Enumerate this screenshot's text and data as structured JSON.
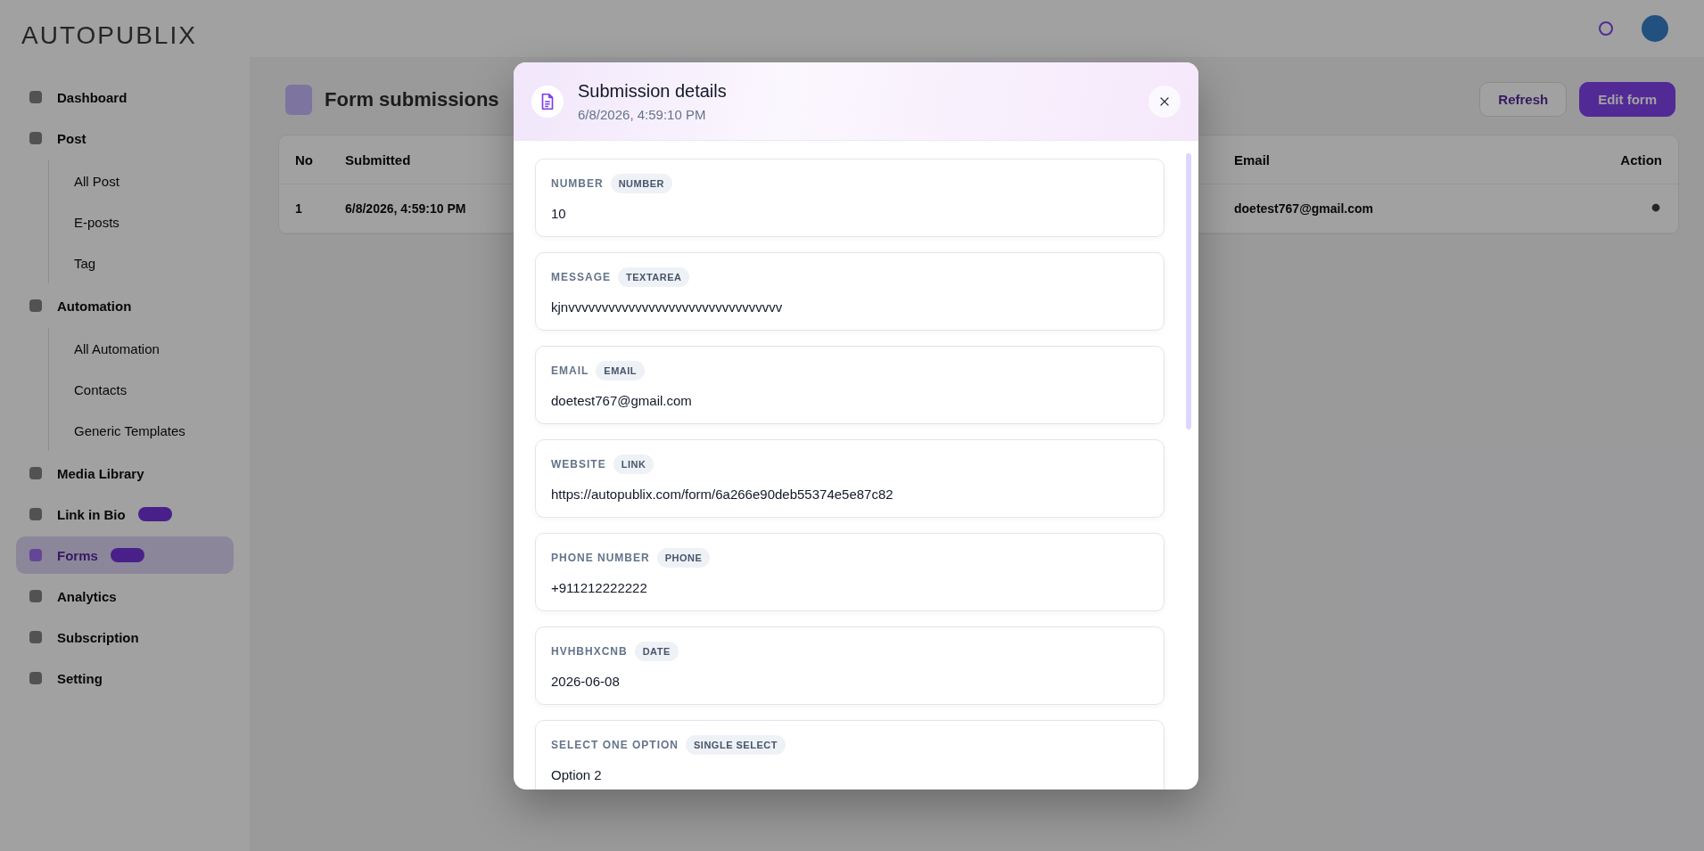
{
  "brand": {
    "logo": "AUTOPUBLIX"
  },
  "sidebar": {
    "items": [
      {
        "label": "Dashboard",
        "selected": false,
        "badge": false
      },
      {
        "label": "Post",
        "selected": false,
        "badge": false,
        "children": [
          {
            "label": "All Post"
          },
          {
            "label": "E-posts"
          },
          {
            "label": "Tag"
          }
        ]
      },
      {
        "label": "Automation",
        "selected": false,
        "badge": false,
        "children": [
          {
            "label": "All Automation"
          },
          {
            "label": "Contacts"
          },
          {
            "label": "Generic Templates"
          }
        ]
      },
      {
        "label": "Media Library",
        "selected": false,
        "badge": false
      },
      {
        "label": "Link in Bio",
        "selected": false,
        "badge": true
      },
      {
        "label": "Forms",
        "selected": true,
        "badge": true
      },
      {
        "label": "Analytics",
        "selected": false,
        "badge": false
      },
      {
        "label": "Subscription",
        "selected": false,
        "badge": false
      },
      {
        "label": "Setting",
        "selected": false,
        "badge": false
      }
    ]
  },
  "page": {
    "title": "Form submissions",
    "buttons": [
      "Refresh",
      "Edit form"
    ],
    "table": {
      "columns": [
        "No",
        "Submitted",
        "Email",
        "Action"
      ],
      "rows": [
        {
          "no": "1",
          "submitted": "6/8/2026, 4:59:10 PM",
          "email": "doetest767@gmail.com"
        }
      ]
    }
  },
  "modal": {
    "title": "Submission details",
    "subtitle": "6/8/2026, 4:59:10 PM",
    "fields": [
      {
        "label": "NUMBER",
        "type": "NUMBER",
        "value": "10"
      },
      {
        "label": "MESSAGE",
        "type": "TEXTAREA",
        "value": "kjnvvvvvvvvvvvvvvvvvvvvvvvvvvvvvvvv"
      },
      {
        "label": "EMAIL",
        "type": "EMAIL",
        "value": "doetest767@gmail.com"
      },
      {
        "label": "WEBSITE",
        "type": "LINK",
        "value": "https://autopublix.com/form/6a266e90deb55374e5e87c82"
      },
      {
        "label": "PHONE NUMBER",
        "type": "PHONE",
        "value": "+911212222222"
      },
      {
        "label": "HVHBHXCNB",
        "type": "DATE",
        "value": "2026-06-08"
      },
      {
        "label": "SELECT ONE OPTION",
        "type": "SINGLE SELECT",
        "value": "Option 2"
      }
    ]
  }
}
